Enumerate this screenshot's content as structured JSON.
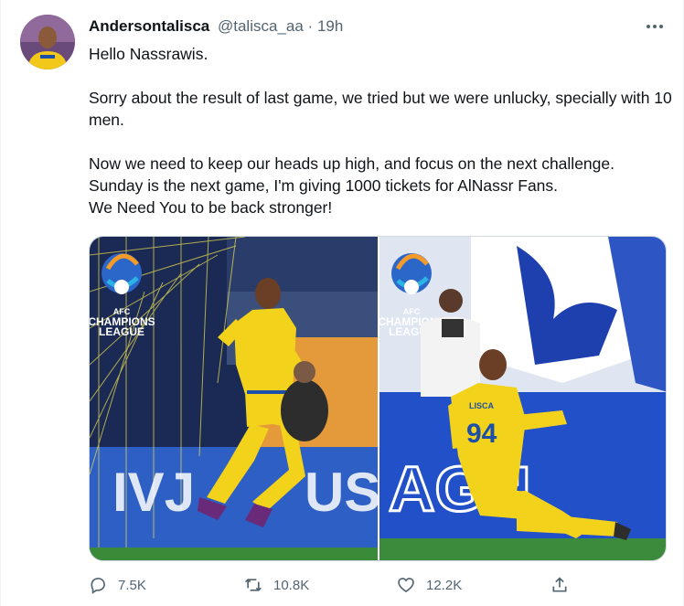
{
  "author": {
    "name": "Andersontalisca",
    "handle": "@talisca_aa",
    "separator": "·",
    "time": "19h"
  },
  "more_icon": "ellipsis-icon",
  "tweet": {
    "lines": [
      "Hello Nassrawis.",
      "",
      "Sorry about the result of last game, we tried but we were unlucky, specially with 10 men.",
      "",
      "Now we need to keep our heads up high, and focus on the next challenge.",
      "Sunday is the next game, I'm giving 1000 tickets for AlNassr Fans.",
      "We Need You to be back stronger!"
    ]
  },
  "media": {
    "logo_line1": "AFC",
    "logo_line2": "CHAMPIONS",
    "logo_line3": "LEAGUE",
    "jersey_text": "LISCA"
  },
  "actions": {
    "reply": {
      "icon": "reply-icon",
      "count": "7.5K"
    },
    "retweet": {
      "icon": "retweet-icon",
      "count": "10.8K"
    },
    "like": {
      "icon": "heart-icon",
      "count": "12.2K"
    },
    "share": {
      "icon": "share-icon"
    }
  },
  "colors": {
    "text": "#0f1419",
    "secondary": "#536471",
    "jersey_yellow": "#f2d21b",
    "jersey_blue": "#1d4fa8"
  }
}
